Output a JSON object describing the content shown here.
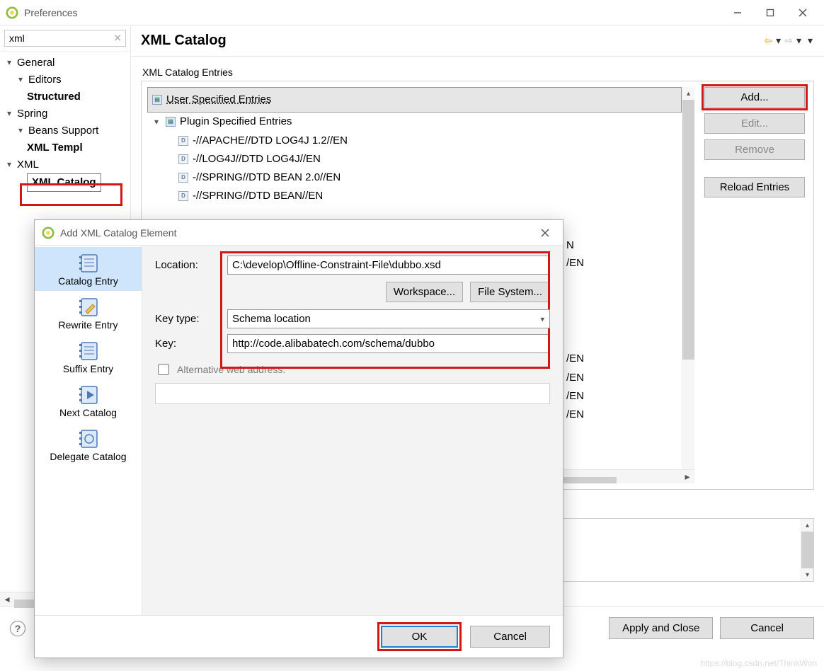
{
  "window": {
    "title": "Preferences",
    "search_value": "xml"
  },
  "tree": {
    "general": "General",
    "editors": "Editors",
    "structured": "Structured ",
    "spring": "Spring",
    "beans_support": "Beans Support",
    "xml_templ": "XML Templ",
    "xml": "XML",
    "xml_catalog": "XML Catalog"
  },
  "header": {
    "title": "XML Catalog"
  },
  "entries": {
    "label": "XML Catalog Entries",
    "user": "User Specified Entries",
    "plugin": "Plugin Specified Entries",
    "list": [
      "-//APACHE//DTD LOG4J 1.2//EN",
      "-//LOG4J//DTD LOG4J//EN",
      "-//SPRING//DTD BEAN 2.0//EN",
      "-//SPRING//DTD BEAN//EN"
    ]
  },
  "peek": {
    "a": "N",
    "b": "/EN",
    "c": "/EN",
    "d": "/EN",
    "e": "/EN",
    "f": "/EN"
  },
  "buttons": {
    "add": "Add...",
    "edit": "Edit...",
    "remove": "Remove",
    "reload": "Reload Entries",
    "apply_close": "Apply and Close",
    "cancel": "Cancel"
  },
  "dialog": {
    "title": "Add XML Catalog Element",
    "tabs": {
      "catalog_entry": "Catalog Entry",
      "rewrite_entry": "Rewrite Entry",
      "suffix_entry": "Suffix Entry",
      "next_catalog": "Next Catalog",
      "delegate_catalog": "Delegate Catalog"
    },
    "form": {
      "location_label": "Location:",
      "location_value": "C:\\develop\\Offline-Constraint-File\\dubbo.xsd",
      "workspace": "Workspace...",
      "filesystem": "File System...",
      "key_type_label": "Key type:",
      "key_type_value": "Schema location",
      "key_label": "Key:",
      "key_value": "http://code.alibabatech.com/schema/dubbo",
      "alt_label": "Alternative web address:"
    },
    "ok": "OK",
    "cancel": "Cancel"
  },
  "watermark": "https://blog.csdn.net/ThinkWon"
}
